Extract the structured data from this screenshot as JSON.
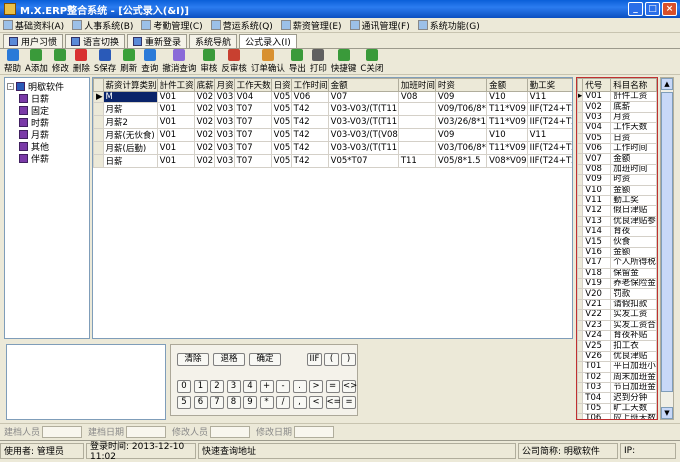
{
  "window": {
    "title": "M.X.ERP整合系统 - [公式录入(&I)]",
    "controls": [
      "_",
      "□",
      "×"
    ]
  },
  "menu": [
    "基础资料(A)",
    "人事系统(B)",
    "考勤管理(C)",
    "营运系统(Q)",
    "薪资管理(E)",
    "通讯管理(F)",
    "系统功能(G)"
  ],
  "tabs": [
    "用户习惯",
    "语言切换",
    "重新登录",
    "系统导航",
    "公式录入(I)"
  ],
  "toolbar": [
    "帮助",
    "A添加",
    "修改",
    "删除",
    "S保存",
    "刷新",
    "查询",
    "撤消查询",
    "审核",
    "反审核",
    "订单确认",
    "导出",
    "打印",
    "快捷键",
    "C关闭"
  ],
  "tree": {
    "root": "明歇软件",
    "items": [
      "日薪",
      "固定",
      "时薪",
      "月薪",
      "其他",
      "伴薪"
    ]
  },
  "grid": {
    "columns": [
      "薪资计算类别",
      "計件工资",
      "底薪",
      "月资",
      "工作天数",
      "日资",
      "工作时间",
      "金额",
      "加班时间",
      "时资",
      "金额",
      "勤工奖",
      "假日"
    ],
    "rows": [
      [
        "M",
        "V01",
        "V02",
        "V03",
        "V04",
        "V05",
        "V06",
        "V07",
        "V08",
        "V09",
        "V10",
        "V11",
        "V12"
      ],
      [
        "月薪",
        "V01",
        "V02",
        "V03",
        "T07",
        "V05",
        "T42",
        "V03-V03/(T(T11",
        "",
        "V09/T06/8*",
        "T11*V09",
        "IIF(T24+T25>8,0,2",
        "V12"
      ],
      [
        "月薪2",
        "V01",
        "V02",
        "V03",
        "T07",
        "V05",
        "T42",
        "V03-V03/(T(T11",
        "",
        "V03/26/8*1",
        "T11*V09",
        "IIF(T24+T25>8,0,2",
        "V12"
      ],
      [
        "月薪(无伙食)",
        "V01",
        "V02",
        "V03",
        "T07",
        "V05",
        "T42",
        "V03-V03/(T(V08",
        "",
        "V09",
        "V10",
        "V11",
        "V12"
      ],
      [
        "月薪(后勤)",
        "V01",
        "V02",
        "V03",
        "T07",
        "V05",
        "T42",
        "V03-V03/(T(T11",
        "",
        "V03/T06/8*",
        "T11*V09",
        "IIF(T24+T25>8,0,2",
        "V12"
      ],
      [
        "日薪",
        "V01",
        "V02",
        "V03",
        "T07",
        "V05",
        "T42",
        "V05*T07",
        "T11",
        "V05/8*1.5",
        "V08*V09",
        "IIF(T24+T25>8,0,2",
        "T36"
      ]
    ]
  },
  "codes": {
    "headers": [
      "代号",
      "科目名称"
    ],
    "rows": [
      [
        "V01",
        "計件工资"
      ],
      [
        "V02",
        "底薪"
      ],
      [
        "V03",
        "月资"
      ],
      [
        "V04",
        "工作天数"
      ],
      [
        "V05",
        "日资"
      ],
      [
        "V06",
        "工作时间"
      ],
      [
        "V07",
        "金额"
      ],
      [
        "V08",
        "加班时间"
      ],
      [
        "V09",
        "时资"
      ],
      [
        "V10",
        "金额"
      ],
      [
        "V11",
        "勤工奖"
      ],
      [
        "V12",
        "假日津贴"
      ],
      [
        "V13",
        "优良津贴参"
      ],
      [
        "V14",
        "育夜"
      ],
      [
        "V15",
        "伙食"
      ],
      [
        "V16",
        "金额"
      ],
      [
        "V17",
        "个人所得税"
      ],
      [
        "V18",
        "保留金"
      ],
      [
        "V19",
        "养老保险金"
      ],
      [
        "V20",
        "罚款"
      ],
      [
        "V21",
        "请假扣款"
      ],
      [
        "V22",
        "实发工资"
      ],
      [
        "V23",
        "实发工资合"
      ],
      [
        "V24",
        "育夜补贴"
      ],
      [
        "V25",
        "扣工衣"
      ],
      [
        "V26",
        "优良津贴"
      ],
      [
        "T01",
        "平日加班小"
      ],
      [
        "T02",
        "周末加班金"
      ],
      [
        "T03",
        "节日加班金"
      ],
      [
        "T04",
        "迟到分钟"
      ],
      [
        "T05",
        "旷工天数"
      ],
      [
        "T06",
        "应上班天数"
      ]
    ]
  },
  "calc": {
    "actions": [
      "清除",
      "退格",
      "确定"
    ],
    "funcs": [
      "IIF",
      "(",
      ")"
    ],
    "row1": [
      "0",
      "1",
      "2",
      "3",
      "4",
      "+",
      "-",
      ".",
      ">",
      "=",
      "<>"
    ],
    "row2": [
      "5",
      "6",
      "7",
      "8",
      "9",
      "*",
      "/",
      ",",
      "<",
      "<=",
      "="
    ]
  },
  "footer": [
    "建档人员",
    "建档日期",
    "修改人员",
    "修改日期"
  ],
  "status": {
    "user": "使用者: 管理员",
    "login": "登录时间: 2013-12-10 11:02",
    "quick": "快速查询地址",
    "company": "公司简称: 明歇软件",
    "ip": "IP:"
  }
}
